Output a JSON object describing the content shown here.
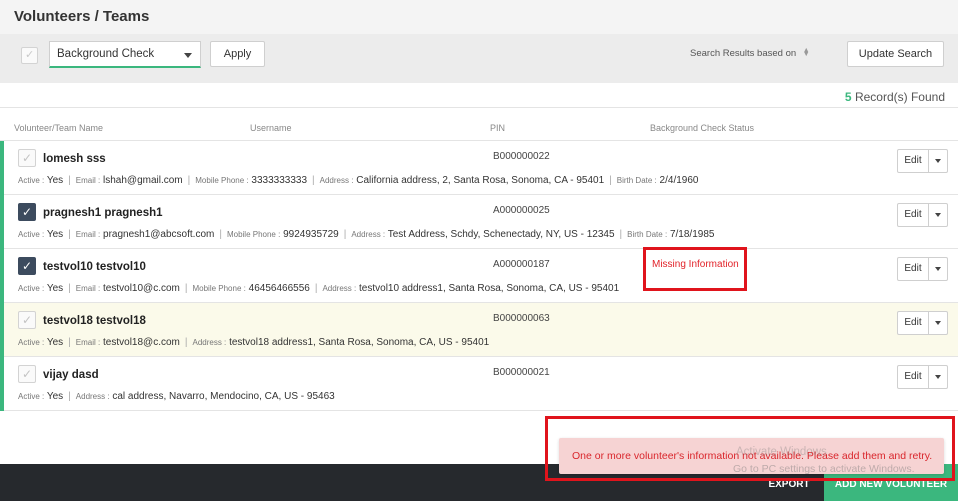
{
  "page": {
    "title": "Volunteers / Teams"
  },
  "toolbar": {
    "filter_value": "Background Check",
    "apply_label": "Apply",
    "search_basis_label": "Search Results based on",
    "update_label": "Update Search"
  },
  "records": {
    "count": "5",
    "label": "Record(s) Found"
  },
  "columns": {
    "name": "Volunteer/Team Name",
    "username": "Username",
    "pin": "PIN",
    "status": "Background Check Status"
  },
  "labels": {
    "active": "Active :",
    "email": "Email :",
    "mobile": "Mobile Phone :",
    "address": "Address :",
    "birth": "Birth Date :",
    "edit": "Edit"
  },
  "rows": [
    {
      "name": "lomesh sss",
      "pin": "B000000022",
      "status": "",
      "checked": false,
      "highlight": false,
      "active": "Yes",
      "email": "lshah@gmail.com",
      "mobile": "3333333333",
      "address": "California address, 2, Santa Rosa, Sonoma, CA - 95401",
      "birth": "2/4/1960"
    },
    {
      "name": "pragnesh1 pragnesh1",
      "pin": "A000000025",
      "status": "",
      "checked": true,
      "highlight": false,
      "active": "Yes",
      "email": "pragnesh1@abcsoft.com",
      "mobile": "9924935729",
      "address": "Test Address, Schdy, Schenectady, NY, US - 12345",
      "birth": "7/18/1985"
    },
    {
      "name": "testvol10 testvol10",
      "pin": "A000000187",
      "status": "Missing Information",
      "checked": true,
      "highlight": false,
      "active": "Yes",
      "email": "testvol10@c.com",
      "mobile": "46456466556",
      "address": "testvol10 address1, Santa Rosa, Sonoma, CA, US - 95401",
      "birth": ""
    },
    {
      "name": "testvol18 testvol18",
      "pin": "B000000063",
      "status": "",
      "checked": false,
      "highlight": true,
      "active": "Yes",
      "email": "testvol18@c.com",
      "mobile": "",
      "address": "testvol18 address1, Santa Rosa, Sonoma, CA, US - 95401",
      "birth": ""
    },
    {
      "name": "vijay dasd",
      "pin": "B000000021",
      "status": "",
      "checked": false,
      "highlight": false,
      "active": "Yes",
      "email": "",
      "mobile": "",
      "address": "cal address, Navarro, Mendocino, CA, US - 95463",
      "birth": ""
    }
  ],
  "toast": {
    "message": "One or more volunteer's information not available. Please add them and retry."
  },
  "footer": {
    "export_label": "EXPORT",
    "add_label": "ADD NEW VOLUNTEER"
  },
  "watermark": {
    "line1": "Activate Windows",
    "line2": "Go to PC settings to activate Windows."
  },
  "colors": {
    "accent": "#3bb77e",
    "error": "#e2232a",
    "annotation": "#e0141c",
    "footer": "#26292d",
    "checked": "#3c4b5e"
  },
  "icons": {
    "check": "check-icon",
    "caret": "chevron-down-icon",
    "sort": "sort-icon"
  }
}
